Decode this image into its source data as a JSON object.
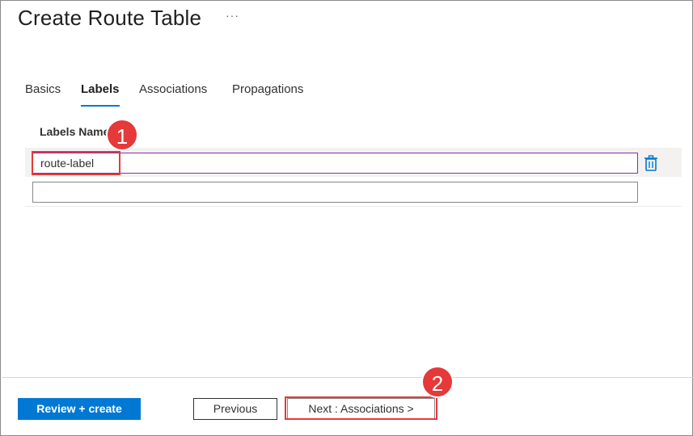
{
  "header": {
    "title": "Create Route Table",
    "more_label": "···"
  },
  "tabs": [
    {
      "label": "Basics",
      "active": false
    },
    {
      "label": "Labels",
      "active": true
    },
    {
      "label": "Associations",
      "active": false
    },
    {
      "label": "Propagations",
      "active": false
    }
  ],
  "labels_table": {
    "column_header": "Labels Name",
    "rows": [
      {
        "value": "route-label",
        "placeholder": ""
      },
      {
        "value": "",
        "placeholder": ""
      }
    ],
    "delete_icon": "trash-icon"
  },
  "annotations": {
    "badge_1": "1",
    "badge_2": "2",
    "color": "#e5393a"
  },
  "footer": {
    "review_create_label": "Review + create",
    "previous_label": "Previous",
    "next_label": "Next : Associations >"
  },
  "colors": {
    "accent": "#0078d4",
    "focus_border": "#8a2da5",
    "delete_icon": "#0078d4"
  }
}
